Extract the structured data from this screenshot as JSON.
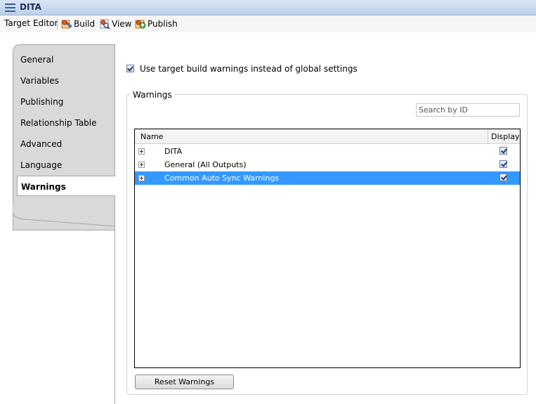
{
  "window": {
    "title": "DITA"
  },
  "toolbar": {
    "label": "Target Editor",
    "buttons": [
      {
        "label": "Build",
        "icon": "build-icon"
      },
      {
        "label": "View",
        "icon": "view-icon"
      },
      {
        "label": "Publish",
        "icon": "publish-icon"
      }
    ]
  },
  "tabs": {
    "items": [
      "General",
      "Variables",
      "Publishing",
      "Relationship Table",
      "Advanced",
      "Language",
      "Warnings"
    ],
    "active": "Warnings"
  },
  "use_target_warnings": {
    "label": "Use target build warnings instead of global settings",
    "checked": true
  },
  "warnings": {
    "group_title": "Warnings",
    "search_placeholder": "Search by ID",
    "columns": [
      "Name",
      "Display"
    ],
    "rows": [
      {
        "name": "DITA",
        "display": true,
        "selected": false
      },
      {
        "name": "General (All Outputs)",
        "display": true,
        "selected": false
      },
      {
        "name": "Common Auto Sync Warnings",
        "display": true,
        "selected": true
      }
    ],
    "reset_label": "Reset Warnings"
  },
  "colors": {
    "selection": "#3399ff",
    "titlebar": "#bcd0ea"
  }
}
